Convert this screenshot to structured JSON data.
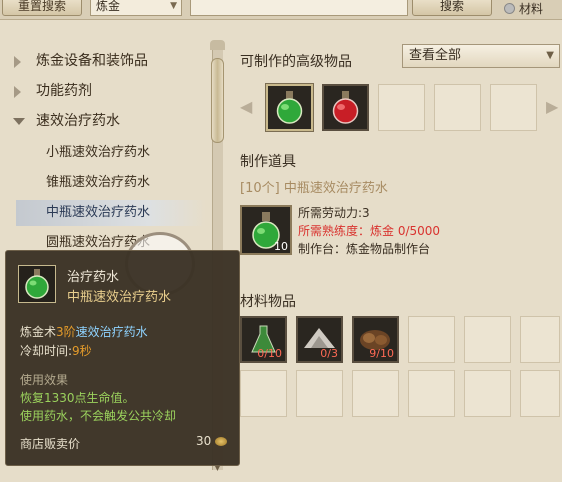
{
  "topbar": {
    "reset_label": "重置搜索",
    "category_value": "炼金",
    "search_label": "搜索",
    "material_label": "材料"
  },
  "tree": {
    "categories": [
      {
        "label": "炼金设备和装饰品",
        "expanded": false
      },
      {
        "label": "功能药剂",
        "expanded": false
      },
      {
        "label": "速效治疗药水",
        "expanded": true
      }
    ],
    "items": [
      {
        "label": "小瓶速效治疗药水"
      },
      {
        "label": "锥瓶速效治疗药水"
      },
      {
        "label": "中瓶速效治疗药水",
        "selected": true
      },
      {
        "label": "圆瓶速效治疗药水"
      }
    ]
  },
  "panel": {
    "title": "可制作的高级物品",
    "view_select": "查看全部",
    "result_items": [
      {
        "icon": "green-potion-icon",
        "active": true
      },
      {
        "icon": "red-potion-icon",
        "active": false
      }
    ],
    "tool_title": "制作道具",
    "recipe_title": "[10个] 中瓶速效治疗药水",
    "tool_count": "10",
    "labor": "所需劳动力:3",
    "proficiency": "所需熟练度：炼金 0/5000",
    "workbench": "制作台：炼金物品制作台",
    "materials_title": "材料物品",
    "materials": [
      {
        "icon": "green-flask-icon",
        "count": "0/10"
      },
      {
        "icon": "powder-pile-icon",
        "count": "0/3"
      },
      {
        "icon": "nut-pile-icon",
        "count": "9/10"
      }
    ]
  },
  "tooltip": {
    "name": "治疗药水",
    "subname": "中瓶速效治疗药水",
    "skill_prefix": "炼金术",
    "skill_level": "3阶",
    "skill_name": "速效治疗药水",
    "cooldown_label": "冷却时间:",
    "cooldown_value": "9秒",
    "effect_label": "使用效果",
    "effect_line1": "恢复1330点生命值。",
    "effect_line2": "使用药水，不会触发公共冷却",
    "price_label": "商店贩卖价",
    "price_value": "30"
  },
  "colors": {
    "background": "#e6ddc9",
    "tooltip_bg": "#3a3124",
    "highlight_cyan": "#8fd3ff",
    "level_orange": "#e49b2a",
    "effect_green": "#9bd25d",
    "warning_red": "#d9332f"
  }
}
